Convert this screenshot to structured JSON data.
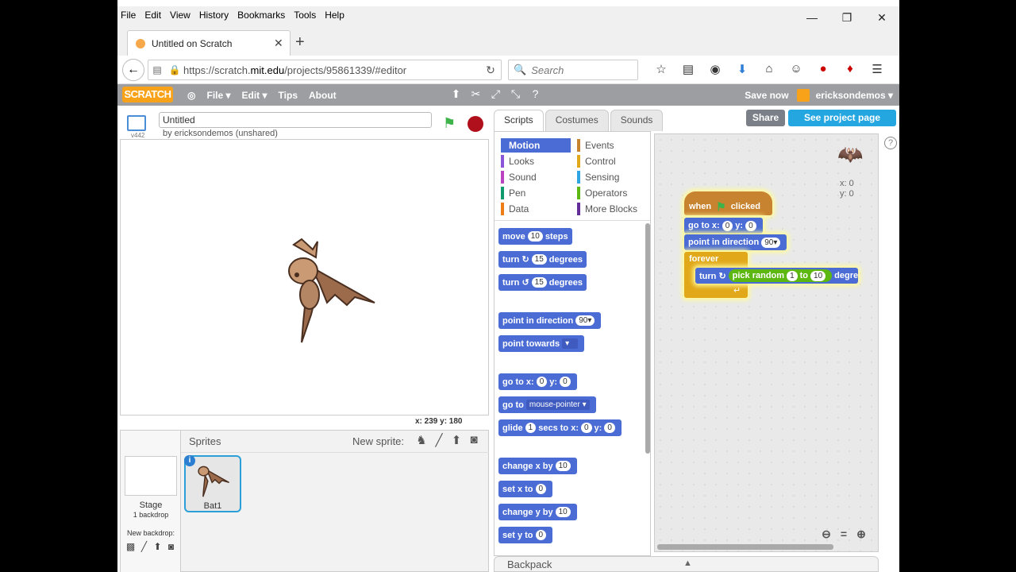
{
  "browser": {
    "menu": [
      "File",
      "Edit",
      "View",
      "History",
      "Bookmarks",
      "Tools",
      "Help"
    ],
    "window_controls": [
      "—",
      "❐",
      "✕"
    ],
    "tab_title": "Untitled on Scratch",
    "url_prefix": "https://scratch.",
    "url_domain": "mit.edu",
    "url_path": "/projects/95861339/#editor",
    "search_placeholder": "Search"
  },
  "scratch": {
    "logo": "SCRATCH",
    "menu": [
      "File ▾",
      "Edit ▾",
      "Tips",
      "About"
    ],
    "save_now": "Save now",
    "username": "ericksondemos ▾",
    "share": "Share",
    "see_project": "See project page",
    "version": "v442",
    "project_title": "Untitled",
    "byline": "by ericksondemos (unshared)",
    "stage_coords": "x: 239   y: 180",
    "sprites_label": "Sprites",
    "new_sprite": "New sprite:",
    "stage_label": "Stage",
    "backdrop_count": "1 backdrop",
    "new_backdrop": "New backdrop:",
    "sprite_name": "Bat1",
    "tabs": [
      "Scripts",
      "Costumes",
      "Sounds"
    ],
    "categories": [
      {
        "name": "Motion",
        "color": "#4a6cd4"
      },
      {
        "name": "Events",
        "color": "#c88330"
      },
      {
        "name": "Looks",
        "color": "#8a55d7"
      },
      {
        "name": "Control",
        "color": "#e1a91a"
      },
      {
        "name": "Sound",
        "color": "#bb42c3"
      },
      {
        "name": "Sensing",
        "color": "#2ca5e2"
      },
      {
        "name": "Pen",
        "color": "#0e9a6c"
      },
      {
        "name": "Operators",
        "color": "#5cb712"
      },
      {
        "name": "Data",
        "color": "#ee7d16"
      },
      {
        "name": "More Blocks",
        "color": "#632d99"
      }
    ],
    "blocks": {
      "move": {
        "a": "move",
        "v": "10",
        "b": "steps"
      },
      "turn_cw": {
        "a": "turn ↻",
        "v": "15",
        "b": "degrees"
      },
      "turn_ccw": {
        "a": "turn ↺",
        "v": "15",
        "b": "degrees"
      },
      "point_dir": {
        "a": "point in direction",
        "v": "90▾"
      },
      "point_towards": {
        "a": "point towards",
        "v": "▾"
      },
      "goto_xy": {
        "a": "go to x:",
        "x": "0",
        "b": "y:",
        "y": "0"
      },
      "goto": {
        "a": "go to",
        "v": "mouse-pointer ▾"
      },
      "glide": {
        "a": "glide",
        "v": "1",
        "b": "secs to x:",
        "x": "0",
        "c": "y:",
        "y": "0"
      },
      "change_x": {
        "a": "change x by",
        "v": "10"
      },
      "set_x": {
        "a": "set x to",
        "v": "0"
      },
      "change_y": {
        "a": "change y by",
        "v": "10"
      },
      "set_y": {
        "a": "set y to",
        "v": "0"
      }
    },
    "script": {
      "when": "when",
      "clicked": "clicked",
      "goto": {
        "a": "go to x:",
        "x": "0",
        "b": "y:",
        "y": "0"
      },
      "point": {
        "a": "point in direction",
        "v": "90▾"
      },
      "forever": "forever",
      "turn": "turn ↻",
      "pick": "pick random",
      "from": "1",
      "to": "to",
      "top": "10",
      "degrees": "degre"
    },
    "sprite_x": "x: 0",
    "sprite_y": "y: 0",
    "backpack": "Backpack"
  }
}
